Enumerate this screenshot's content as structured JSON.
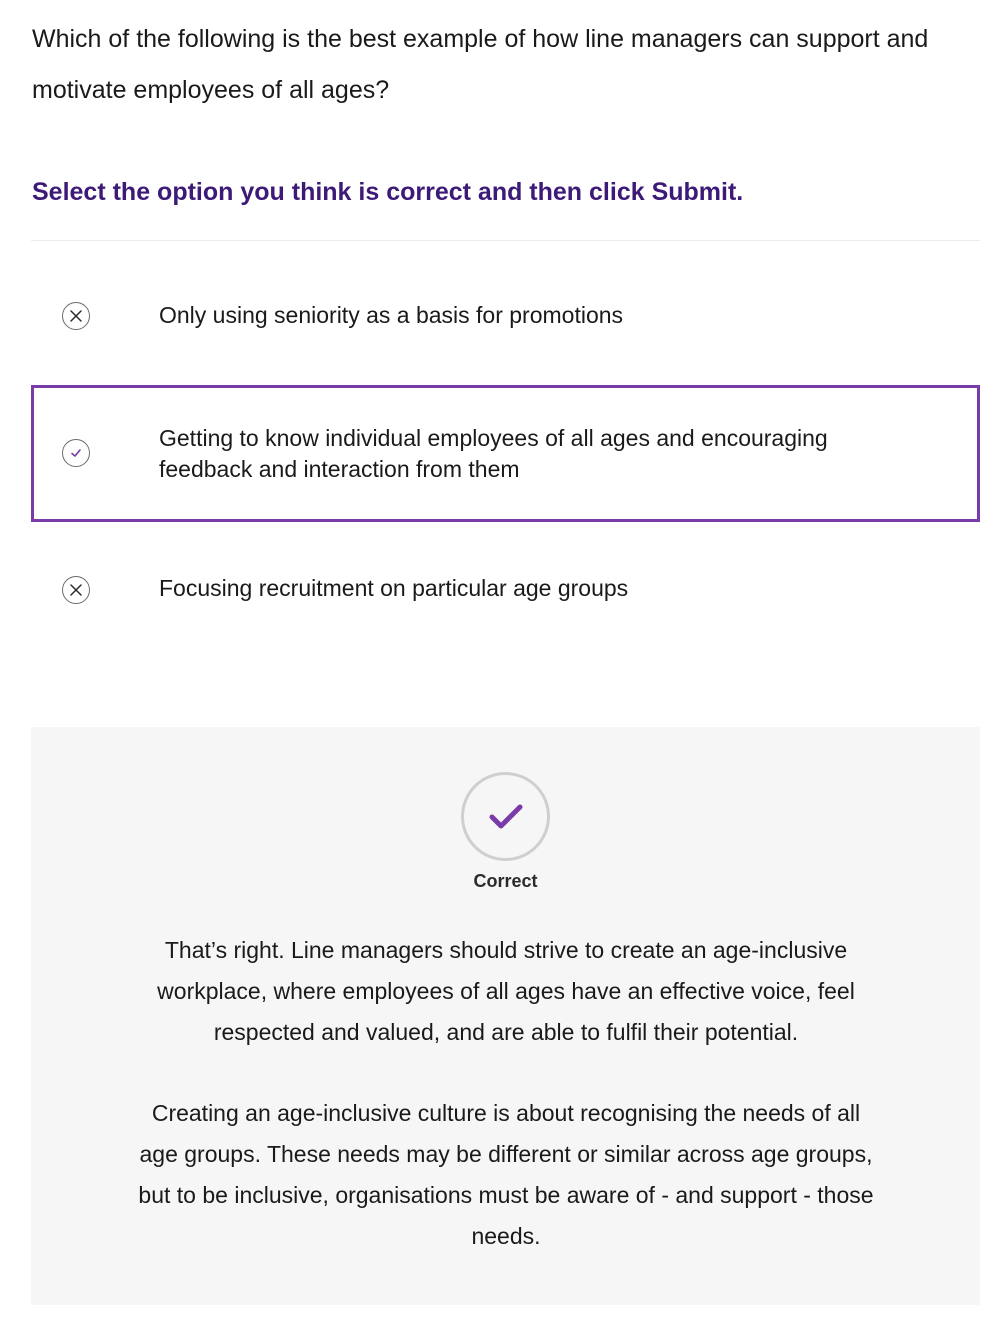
{
  "question": {
    "text": "Which of the following is the best example of how line managers can support and motivate employees of all ages?",
    "instruction": "Select the option you think is correct and then click Submit."
  },
  "options": [
    {
      "label": "Only using seniority as a basis for promotions",
      "icon": "x-circle-icon",
      "state": "incorrect"
    },
    {
      "label": "Getting to know individual employees of all ages and encouraging feedback and interaction from them",
      "icon": "check-circle-icon",
      "state": "selected-correct"
    },
    {
      "label": "Focusing recruitment on particular age groups",
      "icon": "x-circle-icon",
      "state": "incorrect"
    }
  ],
  "feedback": {
    "status": "Correct",
    "icon": "checkmark-icon",
    "paragraphs": [
      "That’s right. Line managers should strive to create an age-inclusive workplace, where employees of all ages have an effective voice, feel respected and valued, and are able to fulfil their potential.",
      "Creating an age-inclusive culture is about recognising the needs of all age groups. These needs may be different or similar across age groups, but to be inclusive, organisations must be aware of - and support - those needs."
    ]
  },
  "colors": {
    "accent": "#7a3aa8",
    "instruction": "#3d1a78",
    "feedback_bg": "#f6f6f6",
    "text": "#1a1a1a"
  }
}
